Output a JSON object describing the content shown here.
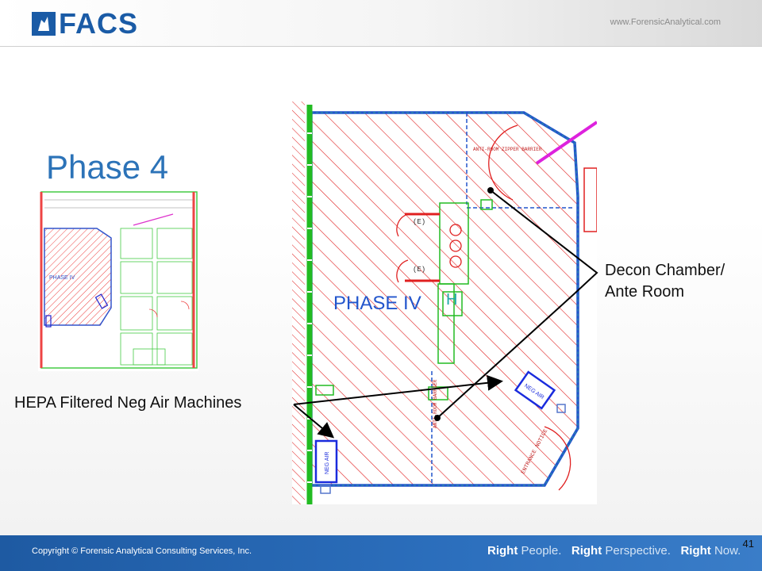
{
  "header": {
    "logo_text": "FACS",
    "url": "www.ForensicAnalytical.com"
  },
  "slide": {
    "title": "Phase 4",
    "number": "41"
  },
  "thumbnail": {
    "phase_label": "PHASE IV"
  },
  "plan": {
    "phase_label": "PHASE IV",
    "annotations": {
      "anti_room_zipper": "ANTI-ROOM ZIPPER BARRIER",
      "anti_room_barrier": "ANTI-ROOM BARRIER",
      "neg_air": "NEG AIR",
      "e_label": "(E)",
      "h_label": "H",
      "entrance_notice": "ENTRANCE NOTICE"
    }
  },
  "callouts": {
    "decon": "Decon Chamber/ Ante Room",
    "decon_line1": "Decon Chamber/",
    "decon_line2": "Ante Room",
    "hepa": "HEPA Filtered Neg Air Machines"
  },
  "footer": {
    "copyright": "Copyright © Forensic Analytical Consulting Services, Inc.",
    "tag1_bold": "Right",
    "tag1_light": "People.",
    "tag2_bold": "Right",
    "tag2_light": "Perspective.",
    "tag3_bold": "Right",
    "tag3_light": "Now."
  },
  "colors": {
    "brand_blue": "#1a5ba6",
    "title_blue": "#2c73b8",
    "hatch_red": "#e02020",
    "wall_green": "#22bb22",
    "outline_blue": "#2255cc"
  }
}
